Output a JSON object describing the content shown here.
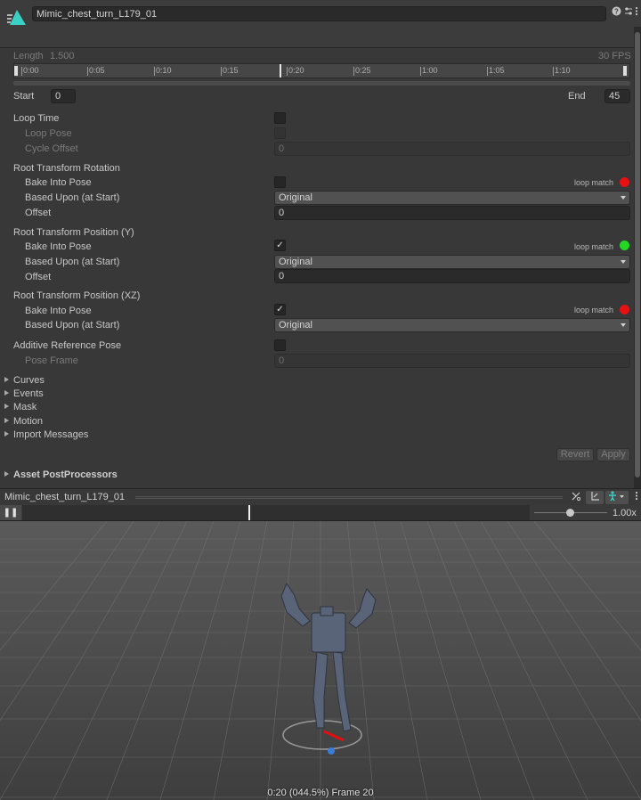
{
  "header": {
    "asset_name": "Mimic_chest_turn_L179_01",
    "icons": [
      "animation-clip-icon",
      "help-icon",
      "preset-sliders-icon",
      "more-menu-icon"
    ]
  },
  "clip": {
    "length_label": "Length",
    "length_value": "1.500",
    "fps": "30 FPS",
    "timeline_ticks": [
      "0:00",
      "0:05",
      "0:10",
      "0:15",
      "0:20",
      "0:25",
      "1:00",
      "1:05",
      "1:10"
    ],
    "start_label": "Start",
    "start_value": "0",
    "end_label": "End",
    "end_value": "45"
  },
  "loop": {
    "loop_time": "Loop Time",
    "loop_pose": "Loop Pose",
    "cycle_offset": "Cycle Offset",
    "cycle_offset_value": "0"
  },
  "root_rotation": {
    "title": "Root Transform Rotation",
    "bake_label": "Bake Into Pose",
    "bake_checked": false,
    "loop_match": "loop match",
    "loop_match_color": "#e81010",
    "based_label": "Based Upon (at Start)",
    "based_value": "Original",
    "offset_label": "Offset",
    "offset_value": "0"
  },
  "root_pos_y": {
    "title": "Root Transform Position (Y)",
    "bake_label": "Bake Into Pose",
    "bake_checked": true,
    "loop_match": "loop match",
    "loop_match_color": "#22d822",
    "based_label": "Based Upon (at Start)",
    "based_value": "Original",
    "offset_label": "Offset",
    "offset_value": "0"
  },
  "root_pos_xz": {
    "title": "Root Transform Position (XZ)",
    "bake_label": "Bake Into Pose",
    "bake_checked": true,
    "loop_match": "loop match",
    "loop_match_color": "#e81010",
    "based_label": "Based Upon (at Start)",
    "based_value": "Original"
  },
  "additive": {
    "title": "Additive Reference Pose",
    "pose_frame": "Pose Frame",
    "pose_frame_value": "0"
  },
  "foldouts": [
    "Curves",
    "Events",
    "Mask",
    "Motion",
    "Import Messages"
  ],
  "buttons": {
    "revert": "Revert",
    "apply": "Apply"
  },
  "postprocessors": "Asset PostProcessors",
  "preview": {
    "title": "Mimic_chest_turn_L179_01",
    "speed": "1.00x",
    "status": "0:20 (044.5%) Frame 20"
  },
  "check_mark": "✓",
  "pause_icon": "❚❚"
}
